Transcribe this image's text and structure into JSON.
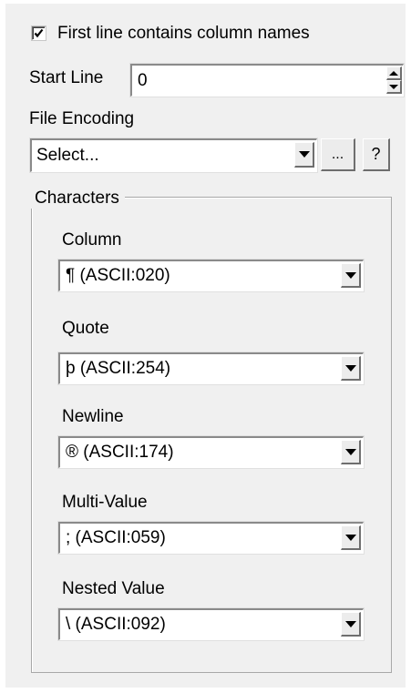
{
  "first_line": {
    "label": "First line contains column names",
    "checked": true
  },
  "start_line": {
    "label": "Start Line",
    "value": "0"
  },
  "file_encoding": {
    "label": "File Encoding",
    "value": "Select...",
    "browse_label": "...",
    "help_label": "?"
  },
  "characters": {
    "title": "Characters",
    "items": [
      {
        "label": "Column",
        "value": "¶ (ASCII:020)"
      },
      {
        "label": "Quote",
        "value": "þ (ASCII:254)"
      },
      {
        "label": "Newline",
        "value": "® (ASCII:174)"
      },
      {
        "label": "Multi-Value",
        "value": "; (ASCII:059)"
      },
      {
        "label": "Nested Value",
        "value": "\\ (ASCII:092)"
      }
    ]
  }
}
